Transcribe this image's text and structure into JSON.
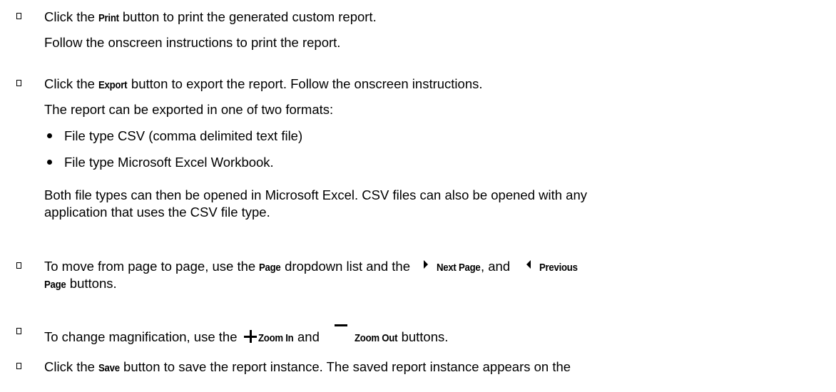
{
  "items": [
    {
      "pre": "Click the ",
      "button": "Print",
      "post": " button to print the generated custom report.",
      "sub": "Follow the onscreen instructions to print the report."
    },
    {
      "pre": "Click the ",
      "button": "Export",
      "post": " button to export the report. Follow the onscreen instructions.",
      "sub": "The report can be exported in one of two formats:",
      "bullets": [
        "File type CSV (comma delimited text file)",
        "File type Microsoft Excel Workbook."
      ],
      "para_line1": "Both file types can then be opened in Microsoft Excel. CSV files can also be opened with any",
      "para_line2": "application that uses the CSV file type."
    },
    {
      "pre": "To move from page to page, use the ",
      "button": "Page",
      "mid": " dropdown list and the ",
      "next_label": "Next Page",
      "sep": ", and ",
      "prev_label": "Previous",
      "line2_label": "Page",
      "line2_post": " buttons.",
      "next_icon": "next-page-icon",
      "prev_icon": "previous-page-icon"
    },
    {
      "pre": "To change magnification, use the ",
      "zoom_in_label": "Zoom In",
      "and": " and ",
      "zoom_out_label": "Zoom Out",
      "post": " buttons.",
      "zoom_in_icon": "plus-icon",
      "zoom_out_icon": "minus-icon"
    },
    {
      "pre": "Click the ",
      "button": "Save",
      "post": " button to save the report instance. The saved report instance appears on the"
    }
  ]
}
